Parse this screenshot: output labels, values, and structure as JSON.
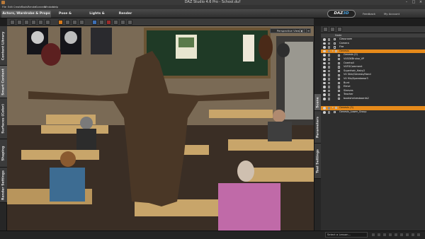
{
  "window": {
    "title": "DAZ Studio 4.6 Pro - School.duf"
  },
  "menu": [
    "File",
    "Edit",
    "Create",
    "Tools",
    "Render",
    "Connect",
    "Window",
    "Help"
  ],
  "rooms": [
    {
      "label": "Actors, Wardrobe & Props",
      "active": true
    },
    {
      "label": "Pose & Animate",
      "active": false
    },
    {
      "label": "Lights & Cameras",
      "active": false
    },
    {
      "label": "Render",
      "active": false
    }
  ],
  "header_right": {
    "logo_text": "DAZ",
    "logo_accent": "3D",
    "feedback": "Feedback",
    "my_account": "My Account"
  },
  "left_tabs": [
    {
      "label": "Content Library",
      "active": false
    },
    {
      "label": "Smart Content",
      "active": true
    },
    {
      "label": "Surfaces (Color)",
      "active": false
    },
    {
      "label": "Shaping",
      "active": false
    },
    {
      "label": "Render Settings",
      "active": false
    }
  ],
  "right_tabs": [
    {
      "label": "Scene",
      "active": true
    },
    {
      "label": "Parameters",
      "active": false
    },
    {
      "label": "Tool Settings",
      "active": false
    }
  ],
  "viewport": {
    "camera": "Perspective View"
  },
  "scene": {
    "column_header": "Node",
    "items": [
      {
        "label": "Classroom",
        "depth": 0,
        "selected": false
      },
      {
        "label": "Camera",
        "depth": 0,
        "selected": false
      },
      {
        "label": "Fire",
        "depth": 0,
        "selected": false
      },
      {
        "label": "Genesis",
        "depth": 0,
        "selected": true
      },
      {
        "label": "Genesis (2)",
        "depth": 1,
        "selected": false
      },
      {
        "label": "V4SGKBruise_VP",
        "depth": 1,
        "selected": false
      },
      {
        "label": "Overhall",
        "depth": 1,
        "selected": false
      },
      {
        "label": "V4FGComment",
        "depth": 1,
        "selected": false
      },
      {
        "label": "Superhair_Hairy2",
        "depth": 1,
        "selected": false
      },
      {
        "label": "V4 Skin/Genesis/Hand",
        "depth": 1,
        "selected": false
      },
      {
        "label": "V4 Mix/Speedwear3",
        "depth": 1,
        "selected": false
      },
      {
        "label": "Bunt",
        "depth": 1,
        "selected": false
      },
      {
        "label": "Eleve",
        "depth": 1,
        "selected": false
      },
      {
        "label": "Sleeves",
        "depth": 1,
        "selected": false
      },
      {
        "label": "Teacher",
        "depth": 1,
        "selected": false
      },
      {
        "label": "bookshelvesboards2",
        "depth": 1,
        "selected": false
      },
      {
        "label": "Genesis (3)",
        "depth": 0,
        "selected": true
      },
      {
        "label": "Genesis_Lower_Group",
        "depth": 0,
        "selected": false
      }
    ]
  },
  "bottom": {
    "lesson_placeholder": "Select a Lesson..."
  },
  "colors": {
    "accent": "#e68a1a",
    "panel": "#2e2e2e",
    "logo_blue": "#4aa3e0"
  }
}
